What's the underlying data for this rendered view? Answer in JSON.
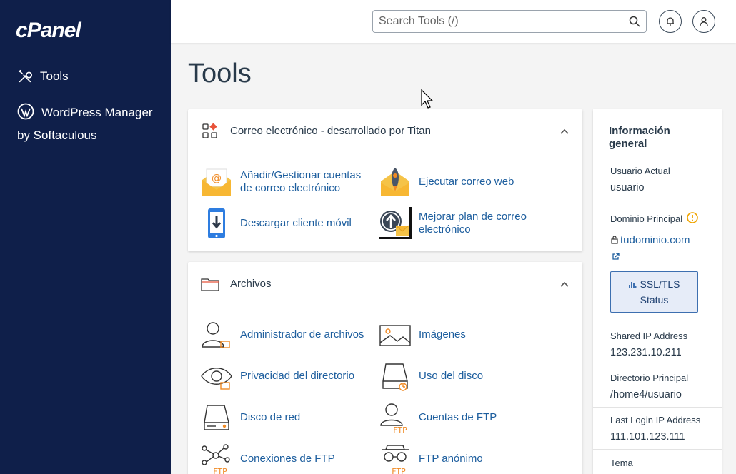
{
  "brand": {
    "logo": "cPanel"
  },
  "sidebar": {
    "items": [
      {
        "label": "Tools",
        "icon": "tools-icon"
      },
      {
        "label": "WordPress Manager by Softaculous",
        "icon": "wordpress-icon"
      }
    ]
  },
  "topbar": {
    "search_placeholder": "Search Tools (/)"
  },
  "page": {
    "title": "Tools"
  },
  "sections": [
    {
      "title": "Correo electrónico - desarrollado por Titan",
      "tools": [
        {
          "label": "Añadir/Gestionar cuentas de correo electrónico",
          "icon": "email-at-icon"
        },
        {
          "label": "Ejecutar correo web",
          "icon": "webmail-rocket-icon"
        },
        {
          "label": "Descargar cliente móvil",
          "icon": "mobile-download-icon"
        },
        {
          "label": "Mejorar plan de correo electrónico",
          "icon": "upgrade-email-icon"
        }
      ]
    },
    {
      "title": "Archivos",
      "tools": [
        {
          "label": "Administrador de archivos",
          "icon": "file-manager-icon"
        },
        {
          "label": "Imágenes",
          "icon": "images-icon"
        },
        {
          "label": "Privacidad del directorio",
          "icon": "directory-privacy-icon"
        },
        {
          "label": "Uso del disco",
          "icon": "disk-usage-icon"
        },
        {
          "label": "Disco de red",
          "icon": "network-disk-icon"
        },
        {
          "label": "Cuentas de FTP",
          "icon": "ftp-accounts-icon"
        },
        {
          "label": "Conexiones de FTP",
          "icon": "ftp-connections-icon"
        },
        {
          "label": "FTP anónimo",
          "icon": "anonymous-ftp-icon"
        }
      ]
    }
  ],
  "info": {
    "title": "Información general",
    "current_user_label": "Usuario Actual",
    "current_user_value": "usuario",
    "main_domain_label": "Dominio Principal",
    "main_domain_value": "tudominio.com",
    "ssl_button_line1": "SSL/TLS",
    "ssl_button_line2": "Status",
    "shared_ip_label": "Shared IP Address",
    "shared_ip_value": "123.231.10.211",
    "home_dir_label": "Directorio Principal",
    "home_dir_value": "/home4/usuario",
    "last_login_label": "Last Login IP Address",
    "last_login_value": "111.101.123.111",
    "theme_label": "Tema"
  },
  "colors": {
    "sidebar_bg": "#0f1f4a",
    "link": "#1d5e9e",
    "accent_orange": "#f08a24"
  }
}
